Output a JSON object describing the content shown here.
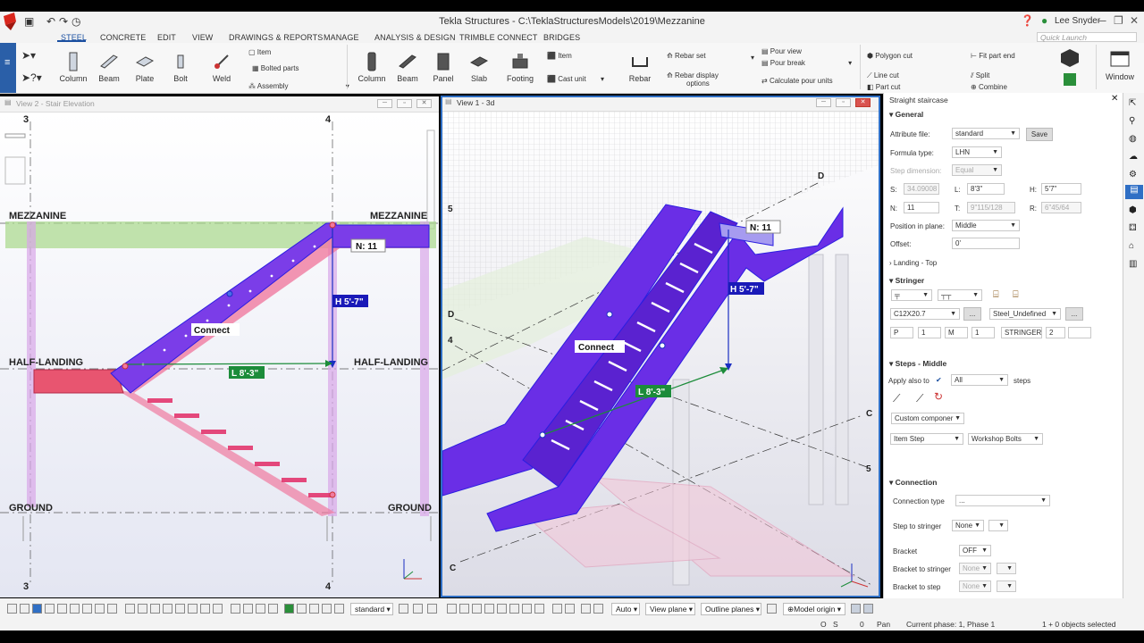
{
  "window": {
    "title": "Tekla Structures - C:\\TeklaStructuresModels\\2019\\Mezzanine",
    "user": "Lee Snyder",
    "quick_launch_placeholder": "Quick Launch"
  },
  "tabs": [
    "STEEL",
    "CONCRETE",
    "EDIT",
    "VIEW",
    "DRAWINGS & REPORTS",
    "MANAGE",
    "ANALYSIS & DESIGN",
    "TRIMBLE CONNECT",
    "BRIDGES"
  ],
  "ribbon": {
    "column": "Column",
    "beam": "Beam",
    "plate": "Plate",
    "bolt": "Bolt",
    "weld": "Weld",
    "item": "Item",
    "bolted_parts": "Bolted parts",
    "assembly": "Assembly",
    "c_column": "Column",
    "c_beam": "Beam",
    "panel": "Panel",
    "slab": "Slab",
    "footing": "Footing",
    "c_item": "Item",
    "cast_unit": "Cast unit",
    "rebar": "Rebar",
    "rebar_set": "Rebar set",
    "rebar_display": "Rebar display",
    "options": "options",
    "pour_view": "Pour view",
    "pour_break": "Pour break",
    "calculate_pour_units": "Calculate pour units",
    "polygon_cut": "Polygon cut",
    "line_cut": "Line cut",
    "part_cut": "Part cut",
    "fit_part_end": "Fit part end",
    "split": "Split",
    "combine": "Combine",
    "window": "Window"
  },
  "view2": {
    "title": "View 2 - Stair Elevation",
    "grid_top_left": "3",
    "grid_top_right": "4",
    "grid_bottom_left": "3",
    "grid_bottom_right": "4",
    "mezzanine_left": "MEZZANINE",
    "mezzanine_right": "MEZZANINE",
    "half_landing_left": "HALF-LANDING",
    "half_landing_right": "HALF-LANDING",
    "ground_left": "GROUND",
    "ground_right": "GROUND",
    "n_label": "N: 11",
    "h_label": "H 5'-7\"",
    "connect": "Connect",
    "l_label": "L 8'-3\""
  },
  "view1": {
    "title": "View 1 - 3d",
    "grid_d_top": "D",
    "grid_5_left": "5",
    "grid_d_left": "D",
    "grid_4_left": "4",
    "grid_c_right": "C",
    "grid_5_right": "5",
    "grid_c_bottom": "C",
    "n_label": "N: 11",
    "h_label": "H 5'-7\"",
    "connect": "Connect",
    "l_label": "L 8'-3\""
  },
  "panel": {
    "title": "Straight staircase",
    "general": "General",
    "attribute_file_label": "Attribute file:",
    "attribute_file": "standard",
    "save": "Save",
    "formula_type_label": "Formula type:",
    "formula_type": "LHN",
    "step_dimension_label": "Step dimension:",
    "step_dimension": "Equal",
    "s_label": "S:",
    "s_value": "34.09008",
    "l_label": "L:",
    "l_value": "8'3\"",
    "h_label": "H:",
    "h_value": "5'7\"",
    "n_label": "N:",
    "n_value": "11",
    "t_label": "T:",
    "t_value": "9\"115/128",
    "r_label": "R:",
    "r_value": "6\"45/64",
    "position_label": "Position in plane:",
    "position": "Middle",
    "offset_label": "Offset:",
    "offset": "0'",
    "landing_top": "Landing - Top",
    "stringer": "Stringer",
    "profile": "C12X20.7",
    "material": "Steel_Undefined",
    "prefix_label": "P",
    "prefix_value": "1",
    "m_label": "M",
    "m_value": "1",
    "name": "STRINGER",
    "class": "2",
    "steps_middle": "Steps - Middle",
    "apply_also_to": "Apply also to",
    "apply_value": "All",
    "steps": "steps",
    "custom_component": "Custom componer",
    "item_step": "Item Step",
    "workshop_bolts": "Workshop Bolts",
    "connection": "Connection",
    "connection_type_label": "Connection type",
    "connection_type": "...",
    "step_to_stringer_label": "Step to stringer",
    "step_to_stringer": "None",
    "bracket_label": "Bracket",
    "bracket": "OFF",
    "bracket_to_stringer_label": "Bracket to stringer",
    "bracket_to_stringer": "None",
    "bracket_to_step_label": "Bracket to step",
    "bracket_to_step": "None"
  },
  "bottom": {
    "standard": "standard",
    "auto": "Auto",
    "view_plane": "View plane",
    "outline_planes": "Outline planes",
    "model_origin": "Model origin",
    "o": "O",
    "s": "S",
    "zero": "0",
    "pan": "Pan",
    "phase": "Current phase: 1, Phase 1",
    "selected": "1 + 0 objects selected"
  },
  "colors": {
    "accent": "#1a4fa0",
    "stair": "#6a2ee6",
    "landing": "#e85570",
    "mezz": "#9fd07a"
  }
}
